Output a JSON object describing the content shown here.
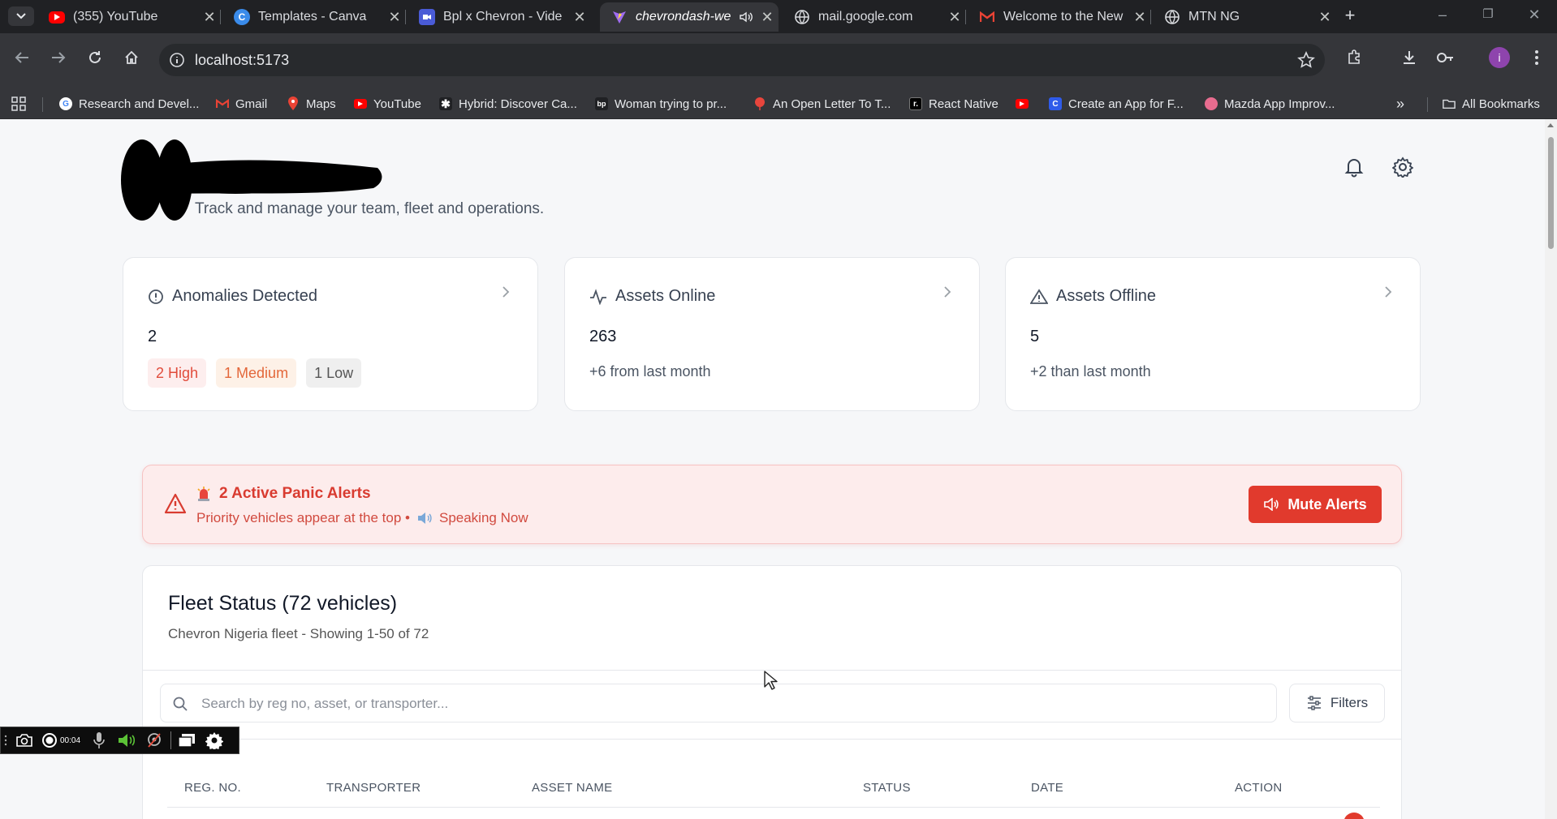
{
  "browser": {
    "tabs": [
      {
        "title": "(355) YouTube",
        "favicon": "youtube-icon",
        "active": false
      },
      {
        "title": "Templates - Canva",
        "favicon": "canva-icon",
        "active": false
      },
      {
        "title": "Bpl x Chevron - Vide",
        "favicon": "video-call-icon",
        "active": false
      },
      {
        "title": "chevrondash-we",
        "favicon": "vite-icon",
        "active": true
      },
      {
        "title": "mail.google.com",
        "favicon": "globe-icon",
        "active": false
      },
      {
        "title": "Welcome to the New",
        "favicon": "gmail-icon",
        "active": false
      },
      {
        "title": "MTN NG",
        "favicon": "globe-icon",
        "active": false
      }
    ],
    "url": "localhost:5173",
    "profile_initial": "i",
    "bookmarks": [
      {
        "label": "Research and Devel...",
        "icon": "google-icon",
        "color": "#ffffff"
      },
      {
        "label": "Gmail",
        "icon": "gmail-icon",
        "color": "#ea4335"
      },
      {
        "label": "Maps",
        "icon": "maps-icon",
        "color": "#34a853"
      },
      {
        "label": "YouTube",
        "icon": "youtube-icon",
        "color": "#ff0000"
      },
      {
        "label": "Hybrid: Discover Ca...",
        "icon": "asterisk-icon",
        "color": "#202124"
      },
      {
        "label": "Woman trying to pr...",
        "icon": "bp-icon",
        "color": "#202124"
      },
      {
        "label": "An Open Letter To T...",
        "icon": "balloon-icon",
        "color": "#e8453c"
      },
      {
        "label": "React Native",
        "icon": "r-icon",
        "color": "#000000"
      },
      {
        "label": "",
        "icon": "youtube-icon",
        "color": "#ff0000"
      },
      {
        "label": "Create an App for F...",
        "icon": "c-icon",
        "color": "#2f5bea"
      },
      {
        "label": "Mazda App Improv...",
        "icon": "dribbble-icon",
        "color": "#e86c8f"
      }
    ],
    "all_bookmarks": "All Bookmarks"
  },
  "header": {
    "subtitle": "Track and manage your team, fleet and operations."
  },
  "cards": {
    "anomalies": {
      "title": "Anomalies Detected",
      "value": "2",
      "pills": {
        "high": "2 High",
        "medium": "1 Medium",
        "low": "1 Low"
      }
    },
    "online": {
      "title": "Assets Online",
      "value": "263",
      "note": "+6 from last month"
    },
    "offline": {
      "title": "Assets Offline",
      "value": "5",
      "note": "+2 than last month"
    }
  },
  "alert": {
    "title": "2 Active Panic Alerts",
    "subtitle": "Priority vehicles appear at the top •",
    "speaking": "Speaking Now",
    "button": "Mute Alerts"
  },
  "fleet": {
    "title": "Fleet Status (72 vehicles)",
    "subtitle": "Chevron Nigeria fleet - Showing 1-50 of 72",
    "search_placeholder": "Search by reg no, asset, or transporter...",
    "filters": "Filters",
    "columns": [
      "REG. NO.",
      "TRANSPORTER",
      "ASSET NAME",
      "STATUS",
      "DATE",
      "ACTION"
    ]
  },
  "recorder": {
    "time": "00:04"
  },
  "colors": {
    "accent_red": "#e13a2d",
    "alert_bg": "#fdecec"
  }
}
